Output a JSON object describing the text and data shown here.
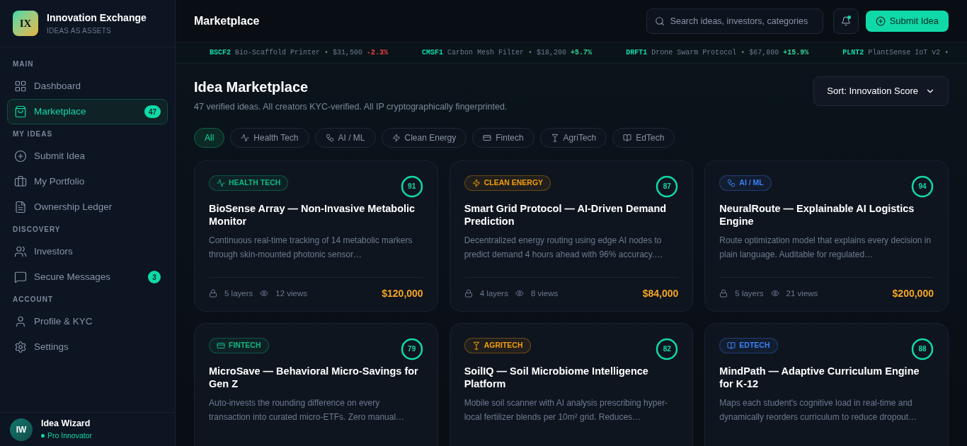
{
  "brand": {
    "logo": "IX",
    "name": "Innovation Exchange",
    "tagline": "IDEAS AS ASSETS"
  },
  "nav_sections": [
    {
      "title": "MAIN",
      "items": [
        {
          "label": "Dashboard",
          "selected": false
        },
        {
          "label": "Marketplace",
          "selected": true,
          "badge": "47"
        }
      ]
    },
    {
      "title": "MY IDEAS",
      "items": [
        {
          "label": "Submit Idea",
          "selected": false
        },
        {
          "label": "My Portfolio",
          "selected": false
        },
        {
          "label": "Ownership Ledger",
          "selected": false
        }
      ]
    },
    {
      "title": "DISCOVERY",
      "items": [
        {
          "label": "Investors",
          "selected": false
        },
        {
          "label": "Secure Messages",
          "selected": false,
          "badge": "3"
        }
      ]
    },
    {
      "title": "ACCOUNT",
      "items": [
        {
          "label": "Profile & KYC",
          "selected": false
        },
        {
          "label": "Settings",
          "selected": false
        }
      ]
    }
  ],
  "user": {
    "initials": "IW",
    "name": "Idea Wizard",
    "role": "Pro Innovator"
  },
  "header": {
    "title": "Marketplace",
    "search_placeholder": "Search ideas, investors, categories",
    "has_unread": true,
    "submit_label": "Submit Idea"
  },
  "ticker": [
    {
      "code": "BSCF2",
      "detail": "Bio-Scaffold Printer • $31,500",
      "change": "-2.3%",
      "negative": true
    },
    {
      "code": "CMSF1",
      "detail": "Carbon Mesh Filter • $18,200",
      "change": "+5.7%",
      "negative": false
    },
    {
      "code": "DRFT1",
      "detail": "Drone Swarm Protocol • $67,800",
      "change": "+15.9%",
      "negative": false
    },
    {
      "code": "PLNT2",
      "detail": "PlantSense IoT v2 •"
    }
  ],
  "page": {
    "title": "Idea Marketplace",
    "subtitle": "47 verified ideas. All creators KYC-verified. All IP cryptographically fingerprinted.",
    "sort": "Sort: Innovation Score"
  },
  "filters": [
    {
      "label": "All",
      "selected": true
    },
    {
      "label": "Health Tech",
      "kind": "health",
      "selected": false
    },
    {
      "label": "AI / ML",
      "kind": "ai",
      "selected": false
    },
    {
      "label": "Clean Energy",
      "kind": "energy",
      "selected": false
    },
    {
      "label": "Fintech",
      "kind": "fintech",
      "selected": false
    },
    {
      "label": "AgriTech",
      "kind": "agri",
      "selected": false
    },
    {
      "label": "EdTech",
      "kind": "edu",
      "selected": false
    }
  ],
  "ideas": [
    {
      "category": "HEALTH TECH",
      "kind": "health",
      "color": "#10b981",
      "score": "91",
      "title": "BioSense Array — Non-Invasive Metabolic Monitor",
      "description": "Continuous real-time tracking of 14 metabolic markers through skin-mounted photonic sensor…",
      "layers": "5 layers",
      "views": "12 views",
      "price": "$120,000"
    },
    {
      "category": "CLEAN ENERGY",
      "kind": "energy",
      "color": "#f59e0b",
      "score": "87",
      "title": "Smart Grid Protocol — AI-Driven Demand Prediction",
      "description": "Decentralized energy routing using edge AI nodes to predict demand 4 hours ahead with 96% accuracy.…",
      "layers": "4 layers",
      "views": "8 views",
      "price": "$84,000"
    },
    {
      "category": "AI / ML",
      "kind": "ai",
      "color": "#3b82f6",
      "score": "94",
      "title": "NeuralRoute — Explainable AI Logistics Engine",
      "description": "Route optimization model that explains every decision in plain language. Auditable for regulated…",
      "layers": "5 layers",
      "views": "21 views",
      "price": "$200,000"
    },
    {
      "category": "FINTECH",
      "kind": "fintech",
      "color": "#10b981",
      "score": "79",
      "title": "MicroSave — Behavioral Micro-Savings for Gen Z",
      "description": "Auto-invests the rounding difference on every transaction into curated micro-ETFs. Zero manual…"
    },
    {
      "category": "AGRITECH",
      "kind": "agri",
      "color": "#f59e0b",
      "score": "82",
      "title": "SoilIQ — Soil Microbiome Intelligence Platform",
      "description": "Mobile soil scanner with AI analysis prescribing hyper-local fertilizer blends per 10m² grid. Reduces…"
    },
    {
      "category": "EDTECH",
      "kind": "edu",
      "color": "#3b82f6",
      "score": "88",
      "title": "MindPath — Adaptive Curriculum Engine for K-12",
      "description": "Maps each student's cognitive load in real-time and dynamically reorders curriculum to reduce dropout…"
    }
  ]
}
